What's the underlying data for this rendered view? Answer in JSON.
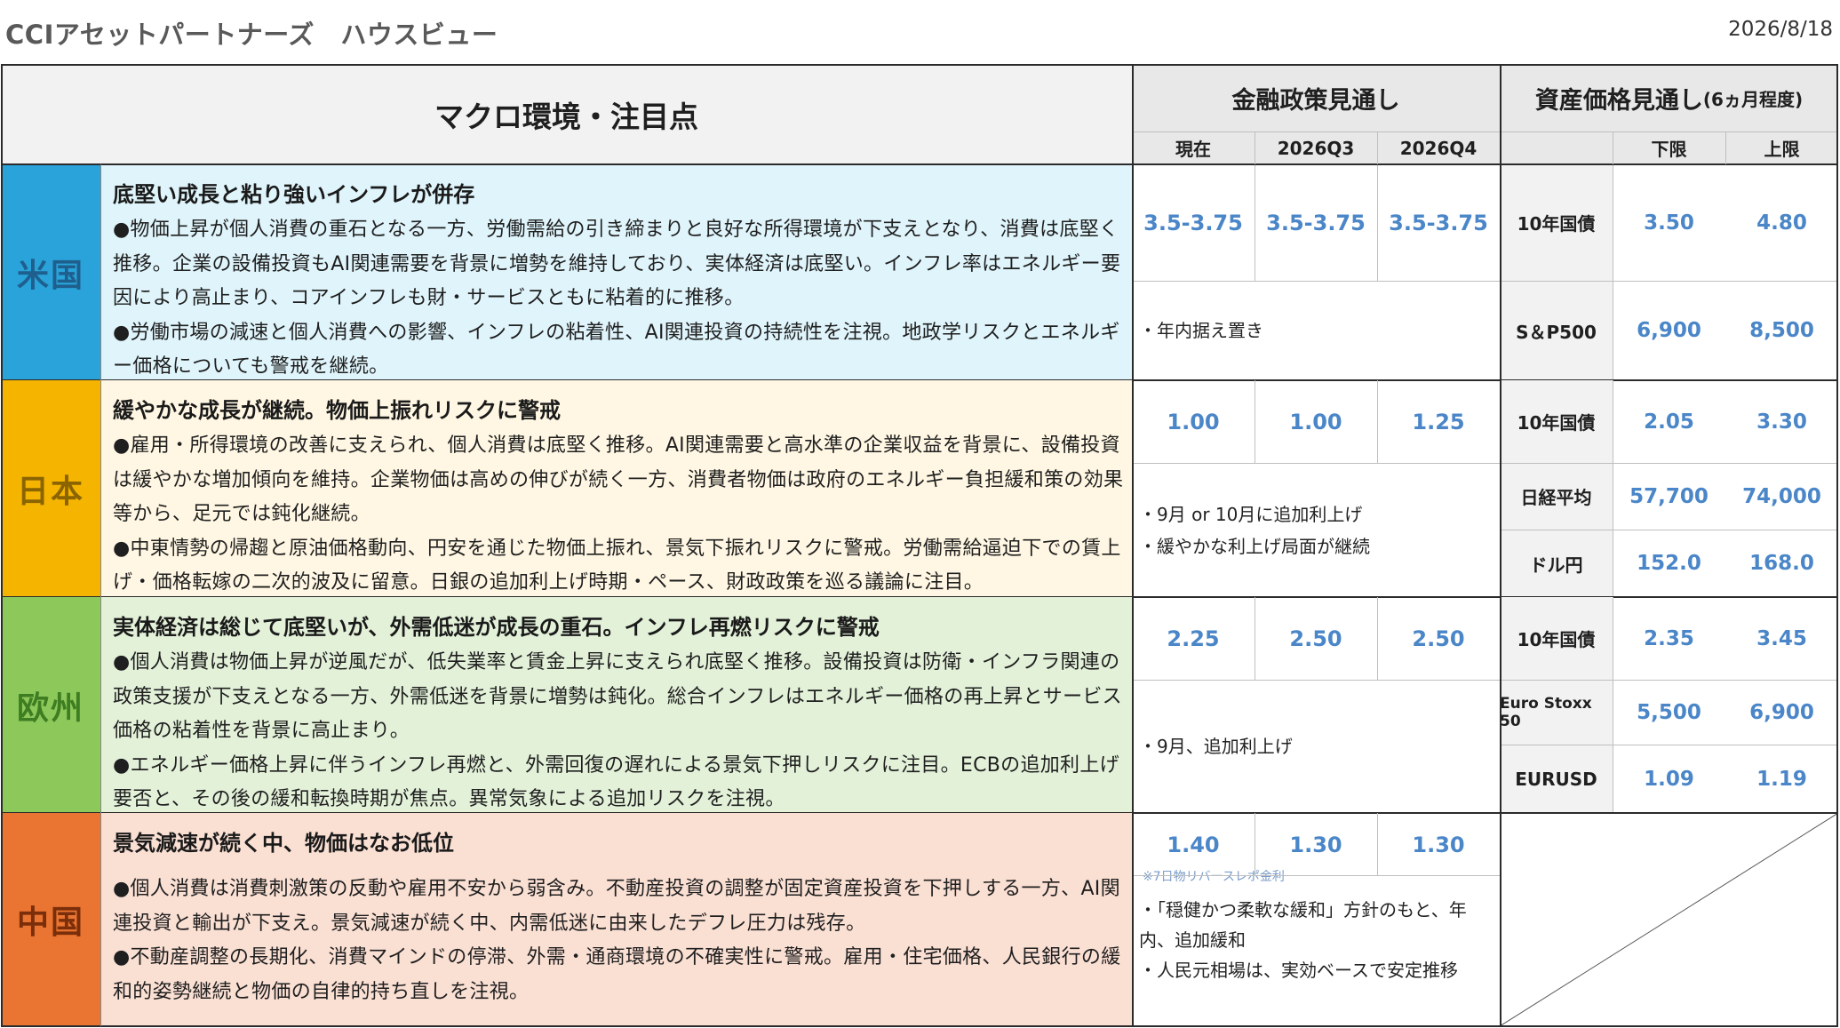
{
  "header": {
    "title": "CCIアセットパートナーズ　ハウスビュー",
    "date": "2026/8/18"
  },
  "columns": {
    "macro": "マクロ環境・注目点",
    "policy": "金融政策見通し",
    "asset": "資産価格見通し",
    "asset_suffix": "(6ヵ月程度)",
    "policy_sub": [
      "現在",
      "2026Q3",
      "2026Q4"
    ],
    "asset_sub": [
      "下限",
      "上限"
    ]
  },
  "regions": [
    {
      "name": "米国",
      "color": "#29a3d9",
      "bg": "#dff4fb",
      "headline": "底堅い成長と粘り強いインフレが併存",
      "paragraphs": [
        "●物価上昇が個人消費の重石となる一方、労働需給の引き締まりと良好な所得環境が下支えとなり、消費は底堅く推移。企業の設備投資もAI関連需要を背景に増勢を維持しており、実体経済は底堅い。インフレ率はエネルギー要因により高止まり、コアインフレも財・サービスともに粘着的に推移。",
        "●労働市場の減速と個人消費への影響、インフレの粘着性、AI関連投資の持続性を注視。地政学リスクとエネルギー価格についても警戒を継続。"
      ],
      "rates": [
        "3.5-3.75",
        "3.5-3.75",
        "3.5-3.75"
      ],
      "notes": [
        "・年内据え置き"
      ],
      "assets": [
        {
          "label": "10年国債",
          "low": "3.50",
          "high": "4.80"
        },
        {
          "label": "S＆P500",
          "low": "6,900",
          "high": "8,500"
        }
      ]
    },
    {
      "name": "日本",
      "color": "#f5b400",
      "bg": "#fff7e3",
      "headline": "緩やかな成長が継続。物価上振れリスクに警戒",
      "paragraphs": [
        "●雇用・所得環境の改善に支えられ、個人消費は底堅く推移。AI関連需要と高水準の企業収益を背景に、設備投資は緩やかな増加傾向を維持。企業物価は高めの伸びが続く一方、消費者物価は政府のエネルギー負担緩和策の効果等から、足元では鈍化継続。",
        "●中東情勢の帰趨と原油価格動向、円安を通じた物価上振れ、景気下振れリスクに警戒。労働需給逼迫下での賃上げ・価格転嫁の二次的波及に留意。日銀の追加利上げ時期・ペース、財政政策を巡る議論に注目。"
      ],
      "rates": [
        "1.00",
        "1.00",
        "1.25"
      ],
      "notes": [
        "・9月 or 10月に追加利上げ",
        "・緩やかな利上げ局面が継続"
      ],
      "assets": [
        {
          "label": "10年国債",
          "low": "2.05",
          "high": "3.30"
        },
        {
          "label": "日経平均",
          "low": "57,700",
          "high": "74,000"
        },
        {
          "label": "ドル円",
          "low": "152.0",
          "high": "168.0"
        }
      ]
    },
    {
      "name": "欧州",
      "color": "#8cc85a",
      "bg": "#e3f1d9",
      "headline": "実体経済は総じて底堅いが、外需低迷が成長の重石。インフレ再燃リスクに警戒",
      "paragraphs": [
        "●個人消費は物価上昇が逆風だが、低失業率と賃金上昇に支えられ底堅く推移。設備投資は防衛・インフラ関連の政策支援が下支えとなる一方、外需低迷を背景に増勢は鈍化。総合インフレはエネルギー価格の再上昇とサービス価格の粘着性を背景に高止まり。",
        "●エネルギー価格上昇に伴うインフレ再燃と、外需回復の遅れによる景気下押しリスクに注目。ECBの追加利上げ要否と、その後の緩和転換時期が焦点。異常気象による追加リスクを注視。"
      ],
      "rates": [
        "2.25",
        "2.50",
        "2.50"
      ],
      "notes": [
        "・9月、追加利上げ"
      ],
      "assets": [
        {
          "label": "10年国債",
          "low": "2.35",
          "high": "3.45"
        },
        {
          "label": "Euro Stoxx 50",
          "low": "5,500",
          "high": "6,900"
        },
        {
          "label": "EURUSD",
          "low": "1.09",
          "high": "1.19"
        }
      ]
    },
    {
      "name": "中国",
      "color": "#ea7431",
      "bg": "#fadfd3",
      "headline": "景気減速が続く中、物価はなお低位",
      "paragraphs": [
        "●個人消費は消費刺激策の反動や雇用不安から弱含み。不動産投資の調整が固定資産投資を下押しする一方、AI関連投資と輸出が下支え。景気減速が続く中、内需低迷に由来したデフレ圧力は残存。",
        "●不動産調整の長期化、消費マインドの停滞、外需・通商環境の不確実性に警戒。雇用・住宅価格、人民銀行の緩和的姿勢継続と物価の自律的持ち直しを注視。"
      ],
      "rates": [
        "1.40",
        "1.30",
        "1.30"
      ],
      "rate_note": "※7日物リバースレポ金利",
      "notes": [
        "・「穏健かつ柔軟な緩和」方針のもと、年内、追加緩和",
        "・人民元相場は、実効ベースで安定推移"
      ],
      "assets": []
    }
  ]
}
